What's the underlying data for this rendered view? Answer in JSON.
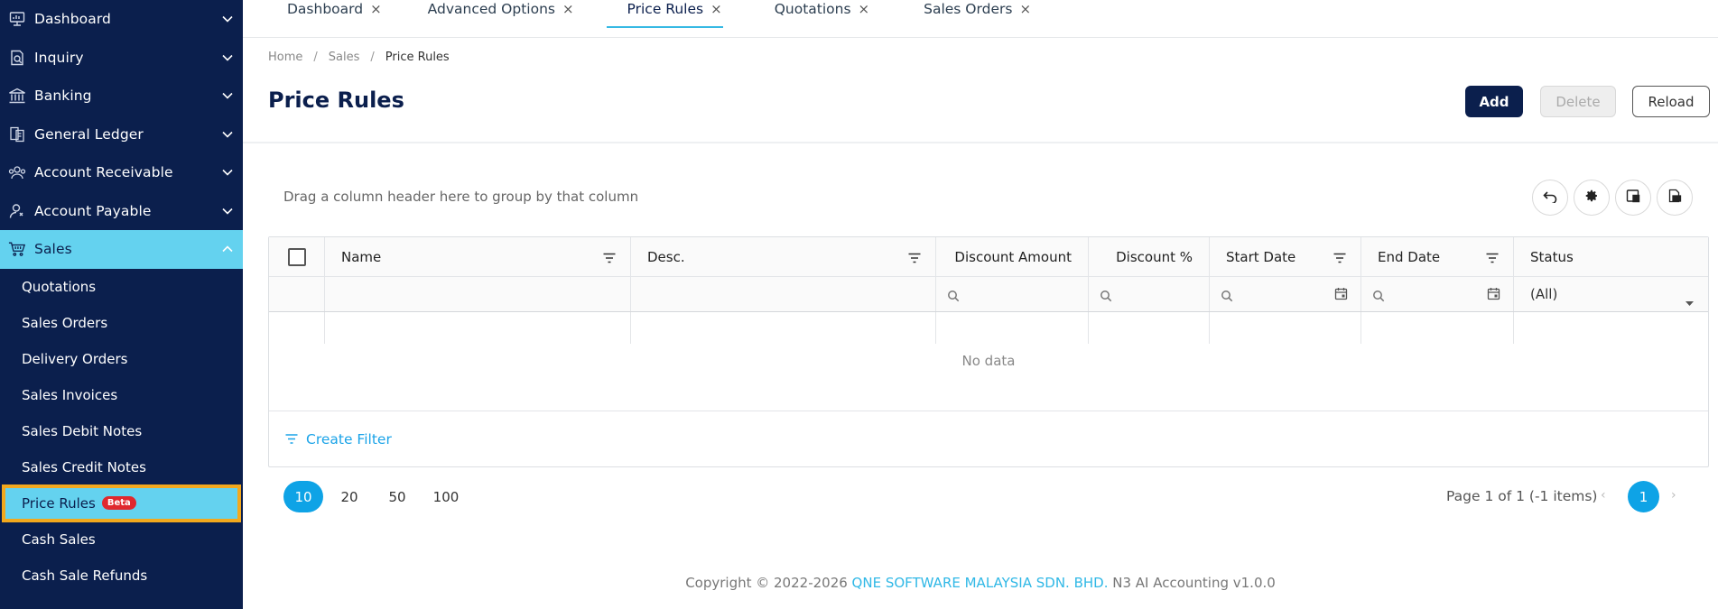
{
  "sidebar": {
    "items": [
      {
        "label": "Dashboard",
        "icon": "dashboard-icon"
      },
      {
        "label": "Inquiry",
        "icon": "inquiry-icon"
      },
      {
        "label": "Banking",
        "icon": "bank-icon"
      },
      {
        "label": "General Ledger",
        "icon": "ledger-icon"
      },
      {
        "label": "Account Receivable",
        "icon": "receivable-icon"
      },
      {
        "label": "Account Payable",
        "icon": "payable-icon"
      },
      {
        "label": "Sales",
        "icon": "cart-icon"
      }
    ],
    "sales_sub": [
      {
        "label": "Quotations"
      },
      {
        "label": "Sales Orders"
      },
      {
        "label": "Delivery Orders"
      },
      {
        "label": "Sales Invoices"
      },
      {
        "label": "Sales Debit Notes"
      },
      {
        "label": "Sales Credit Notes"
      },
      {
        "label": "Price Rules",
        "badge": "Beta"
      },
      {
        "label": "Cash Sales"
      },
      {
        "label": "Cash Sale Refunds"
      }
    ],
    "active_color": "#64d2ef",
    "bg_color": "#0b1f4d"
  },
  "tabs": [
    {
      "label": "Dashboard",
      "close": "×"
    },
    {
      "label": "Advanced Options",
      "close": "×"
    },
    {
      "label": "Price Rules",
      "close": "×"
    },
    {
      "label": "Quotations",
      "close": "×"
    },
    {
      "label": "Sales Orders",
      "close": "×"
    }
  ],
  "breadcrumb": [
    "Home",
    "Sales",
    "Price Rules"
  ],
  "breadcrumb_sep": "/",
  "page": {
    "title": "Price Rules",
    "add_label": "Add",
    "delete_label": "Delete",
    "reload_label": "Reload"
  },
  "grid": {
    "group_hint": "Drag a column header here to group by that column",
    "columns": [
      "Name",
      "Desc.",
      "Discount Amount",
      "Discount %",
      "Start Date",
      "End Date",
      "Status"
    ],
    "status_filter": "(All)",
    "empty_text": "No data",
    "create_filter": "Create Filter",
    "toolbar_icons": [
      "undo-icon",
      "settings-icon",
      "column-chooser-icon",
      "export-icon"
    ]
  },
  "pager": {
    "sizes": [
      "10",
      "20",
      "50",
      "100"
    ],
    "active_size": "10",
    "info": "Page 1 of 1 (-1 items)",
    "prev": "‹",
    "next": "›",
    "current": "1"
  },
  "footer": {
    "prefix": "Copyright © 2022-2026 ",
    "company": "QNE SOFTWARE MALAYSIA SDN. BHD.",
    "suffix": " N3 AI Accounting v1.0.0"
  }
}
